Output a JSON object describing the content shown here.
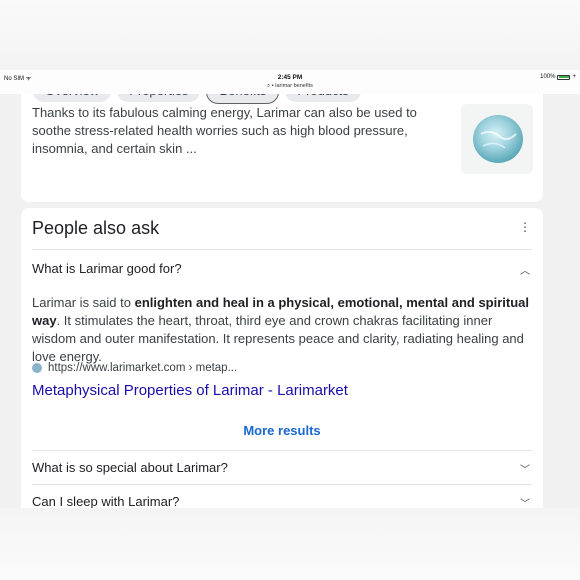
{
  "status_bar": {
    "carrier": "No SIM",
    "wifi_icon": "wifi-icon",
    "time": "2:45 PM",
    "url": "larimar benefits",
    "battery_text": "100%",
    "battery_color": "#3bb14a"
  },
  "chips": [
    "Overview",
    "Properties",
    "Benefits",
    "Products"
  ],
  "card1": {
    "text": "Thanks to its fabulous calming energy, Larimar can also be used to soothe stress-related health worries such as high blood pressure, insomnia, and certain skin ..."
  },
  "paa": {
    "title": "People also ask",
    "questions": [
      "What is Larimar good for?",
      "What is so special about Larimar?",
      "Can I sleep with Larimar?"
    ],
    "answer": {
      "prefix": "Larimar is said to ",
      "bold": "enlighten and heal in a physical, emotional, mental and spiritual way",
      "suffix": ". It stimulates the heart, throat, third eye and crown chakras facilitating inner wisdom and outer manifestation. It represents peace and clarity, radiating healing and love energy."
    },
    "source": "https://www.larimarket.com › metap...",
    "result_title": "Metaphysical Properties of Larimar - Larimarket",
    "more_results": "More results"
  },
  "colors": {
    "link": "#1a0dab",
    "more_results": "#1967d2"
  }
}
